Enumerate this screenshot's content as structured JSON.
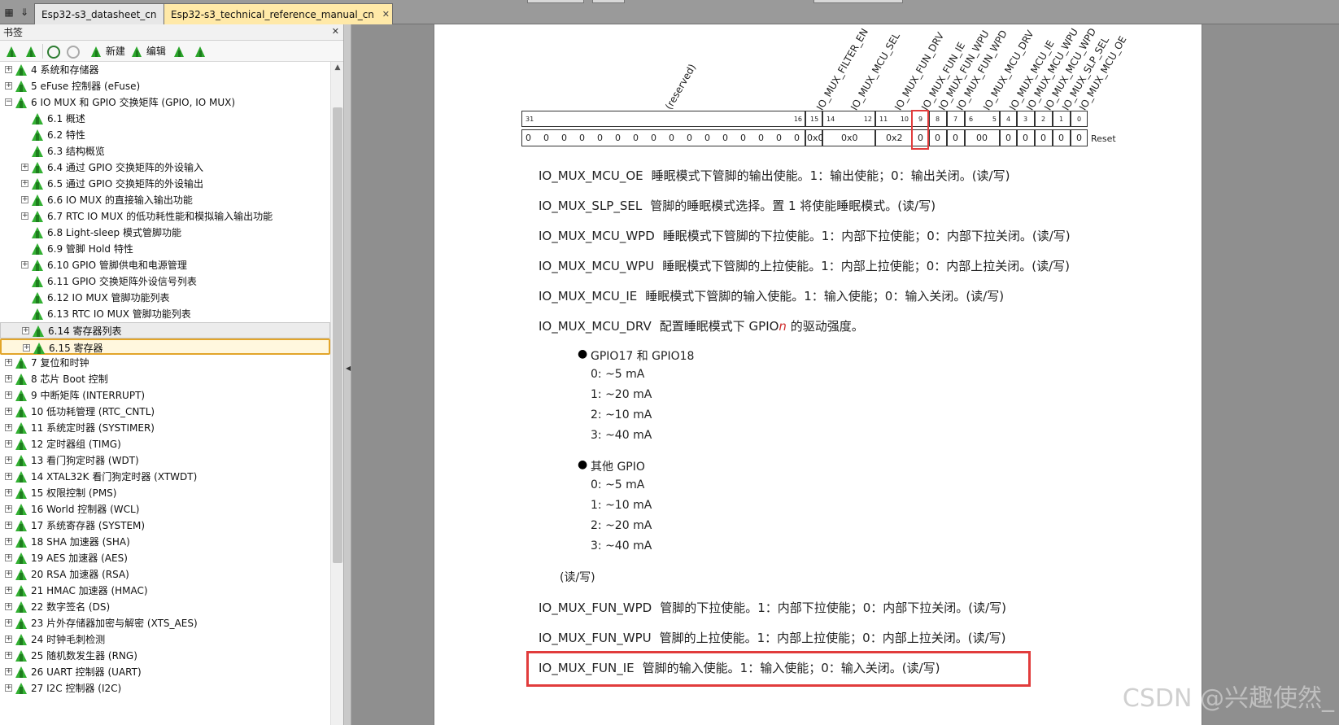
{
  "tabs": [
    {
      "label": "Esp32-s3_datasheet_cn",
      "active": false
    },
    {
      "label": "Esp32-s3_technical_reference_manual_cn",
      "active": true
    }
  ],
  "bookmarks": {
    "title": "书签",
    "toolbar": {
      "new_label": "新建",
      "edit_label": "编辑"
    },
    "items": [
      {
        "label": "4 系统和存储器",
        "level": 0,
        "expand": "+"
      },
      {
        "label": "5 eFuse 控制器 (eFuse)",
        "level": 0,
        "expand": "+"
      },
      {
        "label": "6 IO MUX 和 GPIO 交换矩阵 (GPIO, IO MUX)",
        "level": 0,
        "expand": "-"
      },
      {
        "label": "6.1 概述",
        "level": 1,
        "expand": ""
      },
      {
        "label": "6.2 特性",
        "level": 1,
        "expand": ""
      },
      {
        "label": "6.3 结构概览",
        "level": 1,
        "expand": ""
      },
      {
        "label": "6.4 通过 GPIO 交换矩阵的外设输入",
        "level": 1,
        "expand": "+"
      },
      {
        "label": "6.5 通过 GPIO 交换矩阵的外设输出",
        "level": 1,
        "expand": "+"
      },
      {
        "label": "6.6 IO MUX 的直接输入输出功能",
        "level": 1,
        "expand": "+"
      },
      {
        "label": "6.7 RTC IO MUX 的低功耗性能和模拟输入输出功能",
        "level": 1,
        "expand": "+"
      },
      {
        "label": "6.8 Light-sleep 模式管脚功能",
        "level": 1,
        "expand": ""
      },
      {
        "label": "6.9 管脚 Hold 特性",
        "level": 1,
        "expand": ""
      },
      {
        "label": "6.10 GPIO 管脚供电和电源管理",
        "level": 1,
        "expand": "+"
      },
      {
        "label": "6.11 GPIO 交换矩阵外设信号列表",
        "level": 1,
        "expand": ""
      },
      {
        "label": "6.12 IO MUX 管脚功能列表",
        "level": 1,
        "expand": ""
      },
      {
        "label": "6.13 RTC IO MUX 管脚功能列表",
        "level": 1,
        "expand": ""
      },
      {
        "label": "6.14 寄存器列表",
        "level": 1,
        "expand": "+",
        "state": "hl"
      },
      {
        "label": "6.15 寄存器",
        "level": 1,
        "expand": "+",
        "state": "sel"
      },
      {
        "label": "7 复位和时钟",
        "level": 0,
        "expand": "+"
      },
      {
        "label": "8 芯片 Boot 控制",
        "level": 0,
        "expand": "+"
      },
      {
        "label": "9 中断矩阵 (INTERRUPT)",
        "level": 0,
        "expand": "+"
      },
      {
        "label": "10 低功耗管理 (RTC_CNTL)",
        "level": 0,
        "expand": "+"
      },
      {
        "label": "11 系统定时器 (SYSTIMER)",
        "level": 0,
        "expand": "+"
      },
      {
        "label": "12 定时器组 (TIMG)",
        "level": 0,
        "expand": "+"
      },
      {
        "label": "13 看门狗定时器 (WDT)",
        "level": 0,
        "expand": "+"
      },
      {
        "label": "14 XTAL32K 看门狗定时器 (XTWDT)",
        "level": 0,
        "expand": "+"
      },
      {
        "label": "15 权限控制 (PMS)",
        "level": 0,
        "expand": "+"
      },
      {
        "label": "16 World 控制器 (WCL)",
        "level": 0,
        "expand": "+"
      },
      {
        "label": "17 系统寄存器 (SYSTEM)",
        "level": 0,
        "expand": "+"
      },
      {
        "label": "18 SHA 加速器 (SHA)",
        "level": 0,
        "expand": "+"
      },
      {
        "label": "19 AES 加速器 (AES)",
        "level": 0,
        "expand": "+"
      },
      {
        "label": "20 RSA 加速器 (RSA)",
        "level": 0,
        "expand": "+"
      },
      {
        "label": "21 HMAC 加速器 (HMAC)",
        "level": 0,
        "expand": "+"
      },
      {
        "label": "22 数字签名 (DS)",
        "level": 0,
        "expand": "+"
      },
      {
        "label": "23 片外存储器加密与解密 (XTS_AES)",
        "level": 0,
        "expand": "+"
      },
      {
        "label": "24 时钟毛刺检测",
        "level": 0,
        "expand": "+"
      },
      {
        "label": "25 随机数发生器 (RNG)",
        "level": 0,
        "expand": "+"
      },
      {
        "label": "26 UART 控制器 (UART)",
        "level": 0,
        "expand": "+"
      },
      {
        "label": "27 I2C 控制器 (I2C)",
        "level": 0,
        "expand": "+"
      }
    ]
  },
  "register": {
    "field_labels": [
      "(reserved)",
      "IO_MUX_FILTER_EN",
      "IO_MUX_MCU_SEL",
      "IO_MUX_FUN_DRV",
      "IO_MUX_FUN_IE",
      "IO_MUX_FUN_WPU",
      "IO_MUX_FUN_WPD",
      "IO_MUX_MCU_DRV",
      "IO_MUX_MCU_IE",
      "IO_MUX_MCU_WPU",
      "IO_MUX_MCU_WPD",
      "IO_MUX_SLP_SEL",
      "IO_MUX_MCU_OE"
    ],
    "bit_labels": [
      "31",
      "16",
      "15",
      "14",
      "12",
      "11",
      "10",
      "9",
      "8",
      "7",
      "6",
      "5",
      "4",
      "3",
      "2",
      "1",
      "0"
    ],
    "reserved_values": [
      "0",
      "0",
      "0",
      "0",
      "0",
      "0",
      "0",
      "0",
      "0",
      "0",
      "0",
      "0",
      "0",
      "0",
      "0",
      "0"
    ],
    "values": [
      "0x0",
      "0x0",
      "0x2",
      "0",
      "0",
      "0",
      "00",
      "0",
      "0",
      "0",
      "0",
      "0"
    ],
    "reset_label": "Reset"
  },
  "descriptions": [
    {
      "name": "IO_MUX_MCU_OE",
      "text": "睡眠模式下管脚的输出使能。1：输出使能；0：输出关闭。(读/写)"
    },
    {
      "name": "IO_MUX_SLP_SEL",
      "text": "管脚的睡眠模式选择。置 1 将使能睡眠模式。(读/写)"
    },
    {
      "name": "IO_MUX_MCU_WPD",
      "text": "睡眠模式下管脚的下拉使能。1：内部下拉使能；0：内部下拉关闭。(读/写)"
    },
    {
      "name": "IO_MUX_MCU_WPU",
      "text": "睡眠模式下管脚的上拉使能。1：内部上拉使能；0：内部上拉关闭。(读/写)"
    },
    {
      "name": "IO_MUX_MCU_IE",
      "text": "睡眠模式下管脚的输入使能。1：输入使能；0：输入关闭。(读/写)"
    },
    {
      "name": "IO_MUX_MCU_DRV",
      "text_a": "配置睡眠模式下 GPIO",
      "text_n": "n",
      "text_b": " 的驱动强度。"
    }
  ],
  "drv_groups": [
    {
      "title": "GPIO17 和 GPIO18",
      "levels": [
        "0: ~5 mA",
        "1: ~20 mA",
        "2: ~10 mA",
        "3: ~40 mA"
      ]
    },
    {
      "title": "其他 GPIO",
      "levels": [
        "0: ~5 mA",
        "1: ~10 mA",
        "2: ~20 mA",
        "3: ~40 mA"
      ]
    }
  ],
  "rw_note": "(读/写)",
  "descriptions2": [
    {
      "name": "IO_MUX_FUN_WPD",
      "text": "管脚的下拉使能。1：内部下拉使能；0：内部下拉关闭。(读/写)"
    },
    {
      "name": "IO_MUX_FUN_WPU",
      "text": "管脚的上拉使能。1：内部上拉使能；0：内部上拉关闭。(读/写)"
    },
    {
      "name": "IO_MUX_FUN_IE",
      "text": "管脚的输入使能。1：输入使能；0：输入关闭。(读/写)"
    }
  ],
  "watermark": "CSDN @兴趣使然_"
}
